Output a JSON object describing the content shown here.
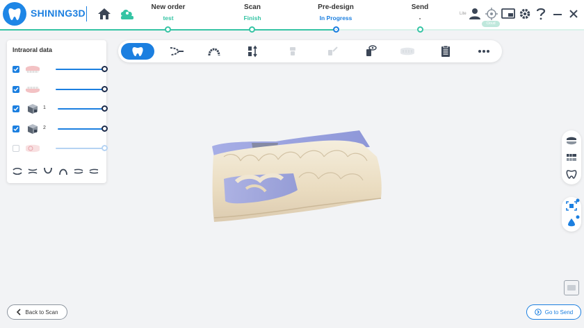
{
  "brand": {
    "name": "SHINING3D"
  },
  "workflow": {
    "steps": [
      {
        "title": "New order",
        "status": "test",
        "status_color": "#35c4a4"
      },
      {
        "title": "Scan",
        "status": "Finish",
        "status_color": "#35c4a4"
      },
      {
        "title": "Pre-design",
        "status": "In Progress",
        "status_color": "#1b7fe0"
      },
      {
        "title": "Send",
        "status": "-",
        "status_color": "#333333"
      }
    ]
  },
  "header_right": {
    "lite_label": "Lite",
    "cloud_label": "Cloud"
  },
  "panel": {
    "title": "Intraoral data",
    "rows": [
      {
        "label": "",
        "checked": true,
        "thumb": "upper-jaw-thumb",
        "opacity": 1.0
      },
      {
        "label": "",
        "checked": true,
        "thumb": "lower-jaw-thumb",
        "opacity": 1.0
      },
      {
        "label": "1",
        "checked": true,
        "thumb": "bite-thumb",
        "opacity": 1.0
      },
      {
        "label": "2",
        "checked": true,
        "thumb": "bite-thumb",
        "opacity": 1.0
      },
      {
        "label": "",
        "checked": false,
        "thumb": "prep-thumb",
        "opacity": 1.0
      }
    ]
  },
  "toolbar": {
    "tools": [
      "tooth-scan-icon",
      "trim-icon",
      "arch-icon",
      "margin-icon",
      "tooth-disabled-icon",
      "brush-disabled-icon",
      "view-tooth-icon",
      "jaw-disabled-icon",
      "report-icon",
      "more-icon"
    ]
  },
  "buttons": {
    "back_label": "Back to Scan",
    "next_label": "Go to Send"
  },
  "colors": {
    "accent": "#1b7fe0",
    "success": "#35c4a4"
  }
}
